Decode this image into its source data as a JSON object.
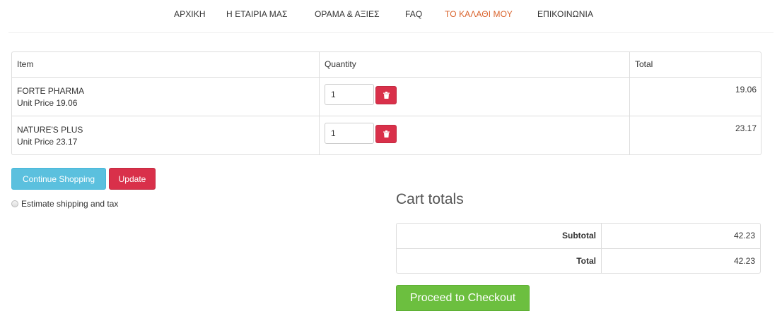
{
  "nav": {
    "items": [
      "ΑΡΧΙΚΗ",
      "Η ΕΤΑΙΡΙΑ ΜΑΣ",
      "ΟΡΑΜΑ & ΑΞΙΕΣ",
      "FAQ",
      "ΤΟ ΚΑΛΑΘΙ ΜΟΥ",
      "ΕΠΙΚΟΙΝΩΝΙΑ"
    ],
    "active_index": 4,
    "active_color": "#d9622b"
  },
  "cart": {
    "headers": {
      "item": "Item",
      "quantity": "Quantity",
      "total": "Total"
    },
    "rows": [
      {
        "name": "FORTE PHARMA",
        "unit_price": "Unit Price 19.06",
        "quantity": "1",
        "total": "19.06"
      },
      {
        "name": "NATURE'S PLUS",
        "unit_price": "Unit Price 23.17",
        "quantity": "1",
        "total": "23.17"
      }
    ],
    "remove_icon": "trash-icon"
  },
  "actions": {
    "continue_label": "Continue Shopping",
    "update_label": "Update",
    "continue_color": "#5bc0de",
    "update_color": "#d9304a"
  },
  "shipping": {
    "estimate_label": "Estimate shipping and tax"
  },
  "totals": {
    "title": "Cart totals",
    "subtotal_label": "Subtotal",
    "subtotal_value": "42.23",
    "total_label": "Total",
    "total_value": "42.23"
  },
  "checkout": {
    "label": "Proceed to Checkout",
    "color": "#6cbf3f"
  }
}
